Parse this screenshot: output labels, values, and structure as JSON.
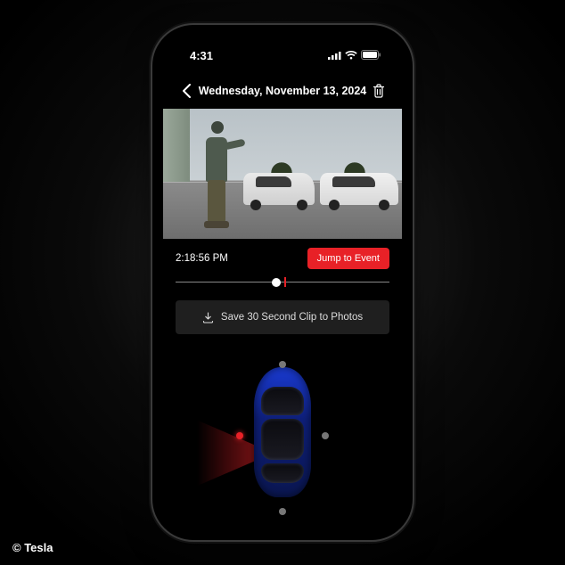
{
  "credit": "© Tesla",
  "status": {
    "time": "4:31"
  },
  "header": {
    "title": "Wednesday, November 13, 2024"
  },
  "playback": {
    "timestamp": "2:18:56 PM",
    "jump_label": "Jump to Event",
    "position_pct": 47,
    "event_pct": 51
  },
  "save": {
    "label": "Save 30 Second Clip to Photos"
  },
  "cameras": {
    "front": {
      "active": false
    },
    "rear": {
      "active": false
    },
    "left": {
      "active": true
    },
    "right": {
      "active": false
    }
  },
  "vehicle": {
    "color": "#1a3bd4"
  }
}
